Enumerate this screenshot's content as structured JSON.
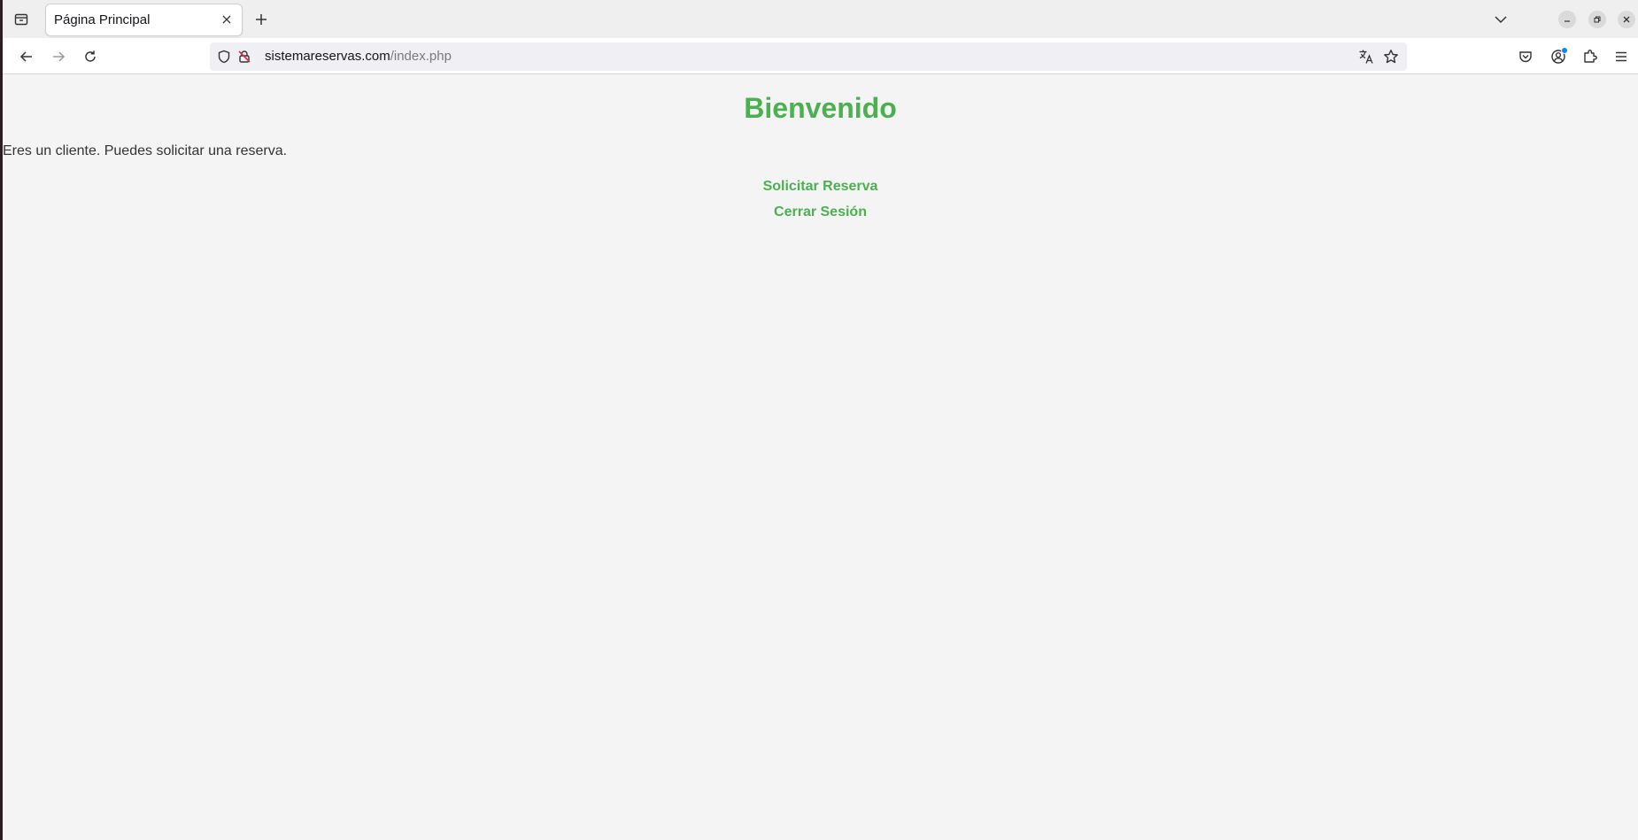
{
  "browser": {
    "tab": {
      "title": "Página Principal"
    },
    "url": {
      "host": "sistemareservas.com",
      "path": "/index.php"
    },
    "colors": {
      "accent": "#4caf50",
      "text": "#333333",
      "background": "#f4f4f4",
      "notification_dot": "#0a84ff"
    },
    "icons": {
      "all_tabs": "all-tabs-icon",
      "close_tab": "close-icon",
      "new_tab": "plus-icon",
      "tab_list": "chevron-down-icon",
      "back": "back-arrow-icon",
      "forward": "forward-arrow-icon",
      "reload": "reload-icon",
      "shield": "shield-icon",
      "insecure": "insecure-lock-icon",
      "translate": "translate-icon",
      "bookmark": "star-icon",
      "pocket": "pocket-icon",
      "account": "account-icon",
      "extensions": "extensions-icon",
      "menu": "hamburger-menu-icon",
      "minimize": "minimize-icon",
      "maximize": "restore-icon",
      "close_window": "close-icon"
    }
  },
  "page": {
    "title": "Bienvenido",
    "role_message": "Eres un cliente. Puedes solicitar una reserva.",
    "links": {
      "request_reservation": "Solicitar Reserva",
      "logout": "Cerrar Sesión"
    }
  }
}
